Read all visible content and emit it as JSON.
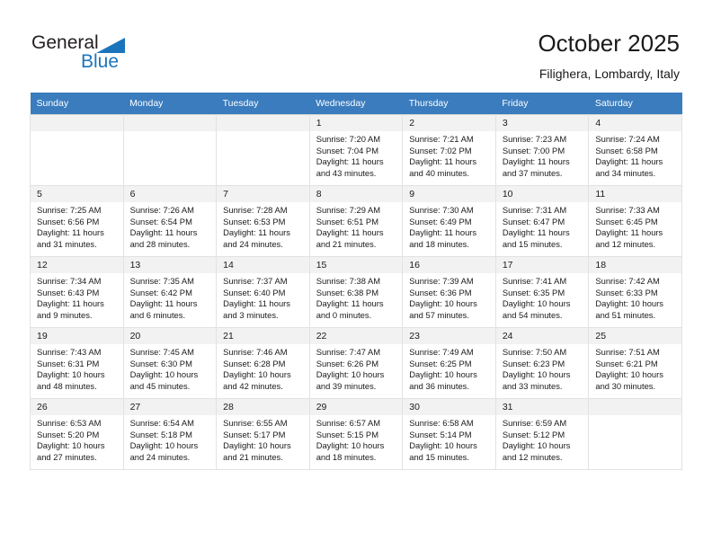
{
  "brand": {
    "line1": "General",
    "line2": "Blue",
    "accent_color": "#1b75bc",
    "triangle_icon": "triangle-icon"
  },
  "header": {
    "title": "October 2025",
    "subtitle": "Filighera, Lombardy, Italy"
  },
  "calendar": {
    "header_bg": "#3a7cbe",
    "daynum_bg": "#f2f2f2",
    "weekdays": [
      "Sunday",
      "Monday",
      "Tuesday",
      "Wednesday",
      "Thursday",
      "Friday",
      "Saturday"
    ],
    "weeks": [
      [
        {
          "day": "",
          "empty": true
        },
        {
          "day": "",
          "empty": true
        },
        {
          "day": "",
          "empty": true
        },
        {
          "day": "1",
          "sunrise": "Sunrise: 7:20 AM",
          "sunset": "Sunset: 7:04 PM",
          "daylight": "Daylight: 11 hours and 43 minutes."
        },
        {
          "day": "2",
          "sunrise": "Sunrise: 7:21 AM",
          "sunset": "Sunset: 7:02 PM",
          "daylight": "Daylight: 11 hours and 40 minutes."
        },
        {
          "day": "3",
          "sunrise": "Sunrise: 7:23 AM",
          "sunset": "Sunset: 7:00 PM",
          "daylight": "Daylight: 11 hours and 37 minutes."
        },
        {
          "day": "4",
          "sunrise": "Sunrise: 7:24 AM",
          "sunset": "Sunset: 6:58 PM",
          "daylight": "Daylight: 11 hours and 34 minutes."
        }
      ],
      [
        {
          "day": "5",
          "sunrise": "Sunrise: 7:25 AM",
          "sunset": "Sunset: 6:56 PM",
          "daylight": "Daylight: 11 hours and 31 minutes."
        },
        {
          "day": "6",
          "sunrise": "Sunrise: 7:26 AM",
          "sunset": "Sunset: 6:54 PM",
          "daylight": "Daylight: 11 hours and 28 minutes."
        },
        {
          "day": "7",
          "sunrise": "Sunrise: 7:28 AM",
          "sunset": "Sunset: 6:53 PM",
          "daylight": "Daylight: 11 hours and 24 minutes."
        },
        {
          "day": "8",
          "sunrise": "Sunrise: 7:29 AM",
          "sunset": "Sunset: 6:51 PM",
          "daylight": "Daylight: 11 hours and 21 minutes."
        },
        {
          "day": "9",
          "sunrise": "Sunrise: 7:30 AM",
          "sunset": "Sunset: 6:49 PM",
          "daylight": "Daylight: 11 hours and 18 minutes."
        },
        {
          "day": "10",
          "sunrise": "Sunrise: 7:31 AM",
          "sunset": "Sunset: 6:47 PM",
          "daylight": "Daylight: 11 hours and 15 minutes."
        },
        {
          "day": "11",
          "sunrise": "Sunrise: 7:33 AM",
          "sunset": "Sunset: 6:45 PM",
          "daylight": "Daylight: 11 hours and 12 minutes."
        }
      ],
      [
        {
          "day": "12",
          "sunrise": "Sunrise: 7:34 AM",
          "sunset": "Sunset: 6:43 PM",
          "daylight": "Daylight: 11 hours and 9 minutes."
        },
        {
          "day": "13",
          "sunrise": "Sunrise: 7:35 AM",
          "sunset": "Sunset: 6:42 PM",
          "daylight": "Daylight: 11 hours and 6 minutes."
        },
        {
          "day": "14",
          "sunrise": "Sunrise: 7:37 AM",
          "sunset": "Sunset: 6:40 PM",
          "daylight": "Daylight: 11 hours and 3 minutes."
        },
        {
          "day": "15",
          "sunrise": "Sunrise: 7:38 AM",
          "sunset": "Sunset: 6:38 PM",
          "daylight": "Daylight: 11 hours and 0 minutes."
        },
        {
          "day": "16",
          "sunrise": "Sunrise: 7:39 AM",
          "sunset": "Sunset: 6:36 PM",
          "daylight": "Daylight: 10 hours and 57 minutes."
        },
        {
          "day": "17",
          "sunrise": "Sunrise: 7:41 AM",
          "sunset": "Sunset: 6:35 PM",
          "daylight": "Daylight: 10 hours and 54 minutes."
        },
        {
          "day": "18",
          "sunrise": "Sunrise: 7:42 AM",
          "sunset": "Sunset: 6:33 PM",
          "daylight": "Daylight: 10 hours and 51 minutes."
        }
      ],
      [
        {
          "day": "19",
          "sunrise": "Sunrise: 7:43 AM",
          "sunset": "Sunset: 6:31 PM",
          "daylight": "Daylight: 10 hours and 48 minutes."
        },
        {
          "day": "20",
          "sunrise": "Sunrise: 7:45 AM",
          "sunset": "Sunset: 6:30 PM",
          "daylight": "Daylight: 10 hours and 45 minutes."
        },
        {
          "day": "21",
          "sunrise": "Sunrise: 7:46 AM",
          "sunset": "Sunset: 6:28 PM",
          "daylight": "Daylight: 10 hours and 42 minutes."
        },
        {
          "day": "22",
          "sunrise": "Sunrise: 7:47 AM",
          "sunset": "Sunset: 6:26 PM",
          "daylight": "Daylight: 10 hours and 39 minutes."
        },
        {
          "day": "23",
          "sunrise": "Sunrise: 7:49 AM",
          "sunset": "Sunset: 6:25 PM",
          "daylight": "Daylight: 10 hours and 36 minutes."
        },
        {
          "day": "24",
          "sunrise": "Sunrise: 7:50 AM",
          "sunset": "Sunset: 6:23 PM",
          "daylight": "Daylight: 10 hours and 33 minutes."
        },
        {
          "day": "25",
          "sunrise": "Sunrise: 7:51 AM",
          "sunset": "Sunset: 6:21 PM",
          "daylight": "Daylight: 10 hours and 30 minutes."
        }
      ],
      [
        {
          "day": "26",
          "sunrise": "Sunrise: 6:53 AM",
          "sunset": "Sunset: 5:20 PM",
          "daylight": "Daylight: 10 hours and 27 minutes."
        },
        {
          "day": "27",
          "sunrise": "Sunrise: 6:54 AM",
          "sunset": "Sunset: 5:18 PM",
          "daylight": "Daylight: 10 hours and 24 minutes."
        },
        {
          "day": "28",
          "sunrise": "Sunrise: 6:55 AM",
          "sunset": "Sunset: 5:17 PM",
          "daylight": "Daylight: 10 hours and 21 minutes."
        },
        {
          "day": "29",
          "sunrise": "Sunrise: 6:57 AM",
          "sunset": "Sunset: 5:15 PM",
          "daylight": "Daylight: 10 hours and 18 minutes."
        },
        {
          "day": "30",
          "sunrise": "Sunrise: 6:58 AM",
          "sunset": "Sunset: 5:14 PM",
          "daylight": "Daylight: 10 hours and 15 minutes."
        },
        {
          "day": "31",
          "sunrise": "Sunrise: 6:59 AM",
          "sunset": "Sunset: 5:12 PM",
          "daylight": "Daylight: 10 hours and 12 minutes."
        },
        {
          "day": "",
          "empty": true
        }
      ]
    ]
  }
}
